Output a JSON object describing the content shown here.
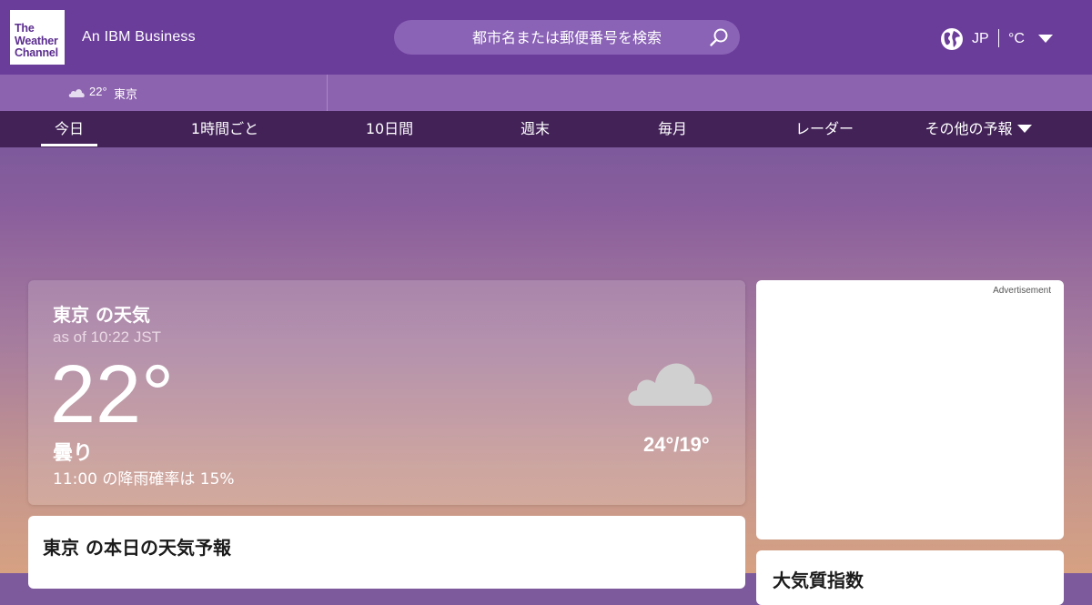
{
  "header": {
    "logo_lines": [
      "The",
      "Weather",
      "Channel"
    ],
    "ibm_text": "An IBM Business",
    "search_placeholder": "都市名または郵便番号を検索",
    "locale": "JP",
    "unit": "°C",
    "brand_color": "#6a3d9a"
  },
  "location_bar": {
    "temp": "22°",
    "city": "東京",
    "icon": "cloud-icon"
  },
  "nav": {
    "tabs": [
      "今日",
      "1時間ごと",
      "10日間",
      "週末",
      "毎月",
      "レーダー",
      "その他の予報"
    ],
    "active_tab": "今日"
  },
  "today": {
    "title": "東京 の天気",
    "as_of": "as of 10:22 JST",
    "temp": "22°",
    "condition": "曇り",
    "precip": "11:00 の降雨確率は 15%",
    "hilo": "24°/19°",
    "icon": "cloud-icon"
  },
  "forecast": {
    "title": "東京 の本日の天気予報"
  },
  "ad": {
    "label": "Advertisement"
  },
  "air": {
    "title": "大気質指数"
  }
}
